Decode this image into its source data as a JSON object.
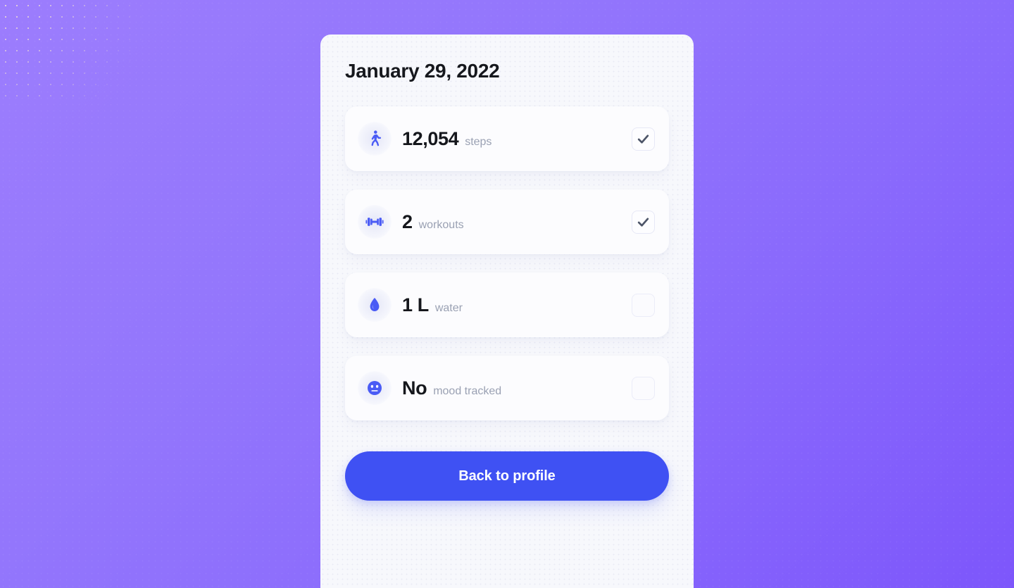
{
  "background": {
    "gradient_from": "#9c7dfd",
    "gradient_to": "#7d56fb"
  },
  "card": {
    "background": "#f7f8fc",
    "title": "January 29, 2022"
  },
  "stats": [
    {
      "icon": "walking-person-icon",
      "value": "12,054",
      "label": "steps",
      "checked": true,
      "check_state": "checked"
    },
    {
      "icon": "dumbbell-icon",
      "value": "2",
      "label": "workouts",
      "checked": true,
      "check_state": "checked"
    },
    {
      "icon": "water-drop-icon",
      "value": "1 L",
      "label": "water",
      "checked": false,
      "check_state": "unchecked"
    },
    {
      "icon": "neutral-face-icon",
      "value": "No",
      "label": "mood tracked",
      "checked": false,
      "check_state": "unchecked"
    }
  ],
  "footer": {
    "back_button_label": "Back to profile",
    "back_button_color": "#3f51f3"
  },
  "colors": {
    "accent_blue": "#3f51f3",
    "icon_blue": "#4a5bf5",
    "value_text": "#15171c",
    "label_text": "#9aa1b3",
    "check_mark": "#4d5568"
  }
}
